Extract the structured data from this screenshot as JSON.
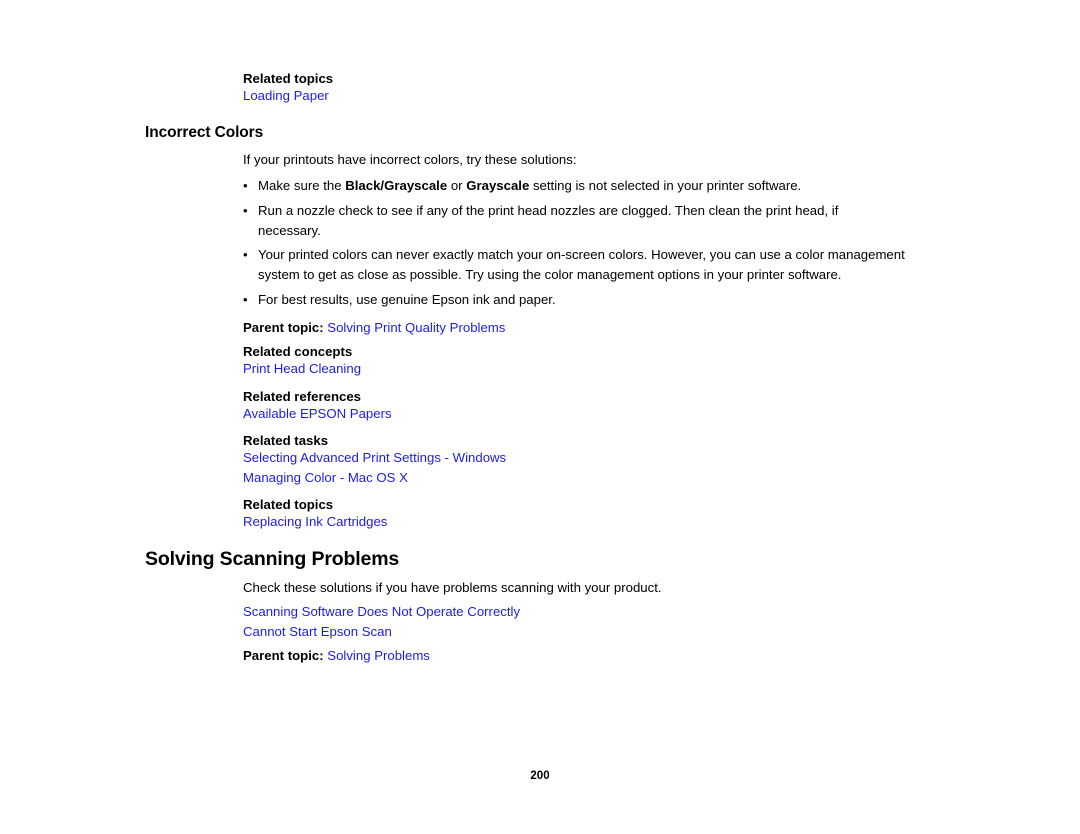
{
  "document": {
    "page_number": "200",
    "link_color": "#1d1de0",
    "text_color": "#000000",
    "background_color": "#ffffff"
  },
  "top_related": {
    "label": "Related topics",
    "links": [
      "Loading Paper"
    ]
  },
  "section_incorrect_colors": {
    "heading": "Incorrect Colors",
    "intro": "If your printouts have incorrect colors, try these solutions:",
    "bullets": [
      {
        "parts": [
          {
            "text": "Make sure the ",
            "bold": false
          },
          {
            "text": "Black/Grayscale",
            "bold": true
          },
          {
            "text": " or ",
            "bold": false
          },
          {
            "text": "Grayscale",
            "bold": true
          },
          {
            "text": " setting is not selected in your printer software.",
            "bold": false
          }
        ]
      },
      {
        "parts": [
          {
            "text": "Run a nozzle check to see if any of the print head nozzles are clogged. Then clean the print head, if necessary.",
            "bold": false
          }
        ]
      },
      {
        "parts": [
          {
            "text": "Your printed colors can never exactly match your on-screen colors. However, you can use a color management system to get as close as possible. Try using the color management options in your printer software.",
            "bold": false
          }
        ]
      },
      {
        "parts": [
          {
            "text": "For best results, use genuine Epson ink and paper.",
            "bold": false
          }
        ]
      }
    ],
    "parent_topic_label": "Parent topic:",
    "parent_topic_link": "Solving Print Quality Problems",
    "related_groups": [
      {
        "label": "Related concepts",
        "links": [
          "Print Head Cleaning"
        ]
      },
      {
        "label": "Related references",
        "links": [
          "Available EPSON Papers"
        ]
      },
      {
        "label": "Related tasks",
        "links": [
          "Selecting Advanced Print Settings - Windows",
          "Managing Color - Mac OS X"
        ]
      },
      {
        "label": "Related topics",
        "links": [
          "Replacing Ink Cartridges"
        ]
      }
    ]
  },
  "section_solving_scanning": {
    "heading": "Solving Scanning Problems",
    "intro": "Check these solutions if you have problems scanning with your product.",
    "links": [
      "Scanning Software Does Not Operate Correctly",
      "Cannot Start Epson Scan"
    ],
    "parent_topic_label": "Parent topic:",
    "parent_topic_link": "Solving Problems"
  }
}
